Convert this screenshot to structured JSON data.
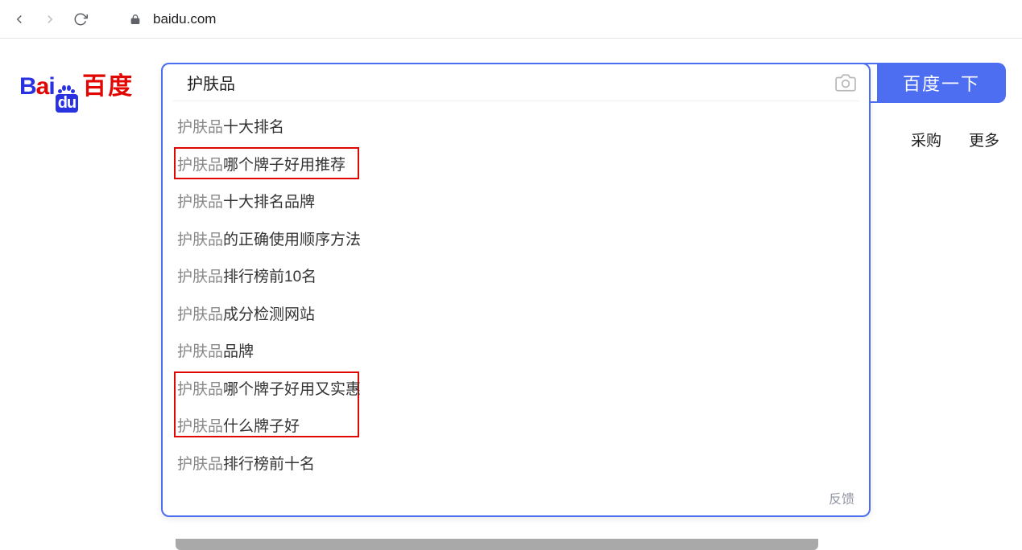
{
  "browser": {
    "url": "baidu.com"
  },
  "logo": {
    "cn": "百度"
  },
  "search": {
    "query": "护肤品",
    "button_label": "百度一下"
  },
  "suggestions": {
    "prefix": "护肤品",
    "items": [
      {
        "suffix": "十大排名",
        "highlighted": false
      },
      {
        "suffix": "哪个牌子好用推荐",
        "highlighted": true,
        "box_group": 1
      },
      {
        "suffix": "十大排名品牌",
        "highlighted": false
      },
      {
        "suffix": "的正确使用顺序方法",
        "highlighted": false
      },
      {
        "suffix": "排行榜前10名",
        "highlighted": false
      },
      {
        "suffix": "成分检测网站",
        "highlighted": false
      },
      {
        "suffix": "品牌",
        "highlighted": false
      },
      {
        "suffix": "哪个牌子好用又实惠",
        "highlighted": true,
        "box_group": 2
      },
      {
        "suffix": "什么牌子好",
        "highlighted": true,
        "box_group": 2
      },
      {
        "suffix": "排行榜前十名",
        "highlighted": false
      }
    ],
    "feedback_label": "反馈"
  },
  "nav": {
    "link1_partial": "采购",
    "link2": "更多"
  }
}
